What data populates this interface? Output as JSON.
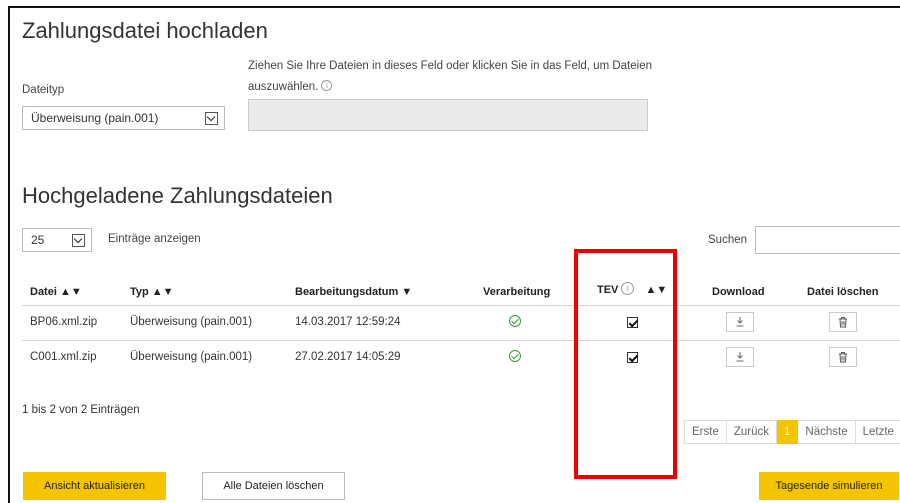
{
  "upload": {
    "title": "Zahlungsdatei hochladen",
    "dateityp_label": "Dateityp",
    "dateityp_value": "Überweisung (pain.001)",
    "drop_hint_line1": "Ziehen Sie Ihre Dateien in dieses Feld oder klicken Sie in das Feld, um Dateien",
    "drop_hint_line2": "auszuwählen.",
    "info_symbol": "i"
  },
  "uploaded": {
    "title": "Hochgeladene Zahlungsdateien",
    "page_size_value": "25",
    "entries_label": "Einträge anzeigen",
    "search_label": "Suchen",
    "search_value": "",
    "columns": {
      "datei": "Datei ▲▼",
      "typ": "Typ ▲▼",
      "datum": "Bearbeitungsdatum ▼",
      "verarbeitung": "Verarbeitung",
      "tev": "TEV",
      "tev_sort": "▲▼",
      "download": "Download",
      "loeschen": "Datei löschen"
    },
    "rows": [
      {
        "datei": "BP06.xml.zip",
        "typ": "Überweisung (pain.001)",
        "datum": "14.03.2017 12:59:24",
        "verarbeitung": "ok",
        "tev": true
      },
      {
        "datei": "C001.xml.zip",
        "typ": "Überweisung (pain.001)",
        "datum": "27.02.2017 14:05:29",
        "verarbeitung": "ok",
        "tev": true
      }
    ],
    "summary": "1 bis 2 von 2 Einträgen",
    "pagination": {
      "first": "Erste",
      "prev": "Zurück",
      "current": "1",
      "next": "Nächste",
      "last": "Letzte"
    }
  },
  "buttons": {
    "refresh": "Ansicht aktualisieren",
    "delete_all": "Alle Dateien löschen",
    "simulate": "Tagesende simulieren"
  },
  "icons": {
    "processing": "check-circle-icon",
    "tev": "checkbox-checked-icon",
    "download": "download-icon",
    "delete": "trash-icon",
    "info": "info-icon"
  },
  "colors": {
    "accent": "#f5c400",
    "success": "#3a9a3a",
    "highlight": "#e00000"
  }
}
